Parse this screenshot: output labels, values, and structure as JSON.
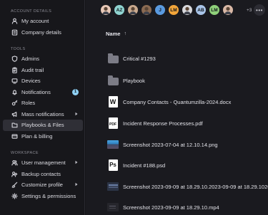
{
  "sidebar": {
    "account_section": "ACCOUNT DETAILS",
    "account_items": [
      {
        "label": "My account",
        "icon": "user-icon"
      },
      {
        "label": "Company details",
        "icon": "building-icon"
      }
    ],
    "tools_section": "TOOLS",
    "tools_items": [
      {
        "label": "Admins",
        "icon": "shield-icon"
      },
      {
        "label": "Audit trail",
        "icon": "clipboard-icon"
      },
      {
        "label": "Devices",
        "icon": "device-icon"
      },
      {
        "label": "Notifications",
        "icon": "bell-icon",
        "badge": "1"
      },
      {
        "label": "Roles",
        "icon": "key-icon"
      },
      {
        "label": "Mass notifications",
        "icon": "megaphone-icon"
      },
      {
        "label": "Playbooks & Files",
        "icon": "folder-icon",
        "active": true
      },
      {
        "label": "Plan & billing",
        "icon": "card-icon"
      }
    ],
    "workspace_section": "WORKSPACE",
    "workspace_items": [
      {
        "label": "User management",
        "icon": "users-icon"
      },
      {
        "label": "Backup contacts",
        "icon": "contacts-icon"
      },
      {
        "label": "Customize profile",
        "icon": "brush-icon"
      },
      {
        "label": "Settings & permissions",
        "icon": "gear-icon"
      }
    ]
  },
  "main": {
    "avatars": [
      {
        "initials": "",
        "color": "#e8c9b8"
      },
      {
        "initials": "AZ",
        "color": "#8fd3d0"
      },
      {
        "initials": "",
        "color": "#c9a98e"
      },
      {
        "initials": "",
        "color": "#8a6a52"
      },
      {
        "initials": "J",
        "color": "#5a9ae0"
      },
      {
        "initials": "LM",
        "color": "#f2a53a"
      },
      {
        "initials": "",
        "color": "#d8d8dc"
      },
      {
        "initials": "AB",
        "color": "#a9c4e8"
      },
      {
        "initials": "LM",
        "color": "#8fd07a"
      },
      {
        "initials": "",
        "color": "#d9b8a6"
      }
    ],
    "more_count": "+3",
    "more_button": "•••",
    "column_header": "Name",
    "sort_indicator": "↑",
    "files": [
      {
        "name": "Critical #1293",
        "type": "folder"
      },
      {
        "name": "Playbook",
        "type": "folder"
      },
      {
        "name": "Company Contacts - Quantumzilla-2024.docx",
        "type": "docx"
      },
      {
        "name": "Incident Response Processes.pdf",
        "type": "pdf"
      },
      {
        "name": "Screenshot 2023-07-04 at 12.10.14.png",
        "type": "image"
      },
      {
        "name": "Incident #188.psd",
        "type": "psd"
      },
      {
        "name": "Screenshot 2023-09-09 at 18.29.10.2023-09-09 at 18.29.1026",
        "type": "screenshot"
      },
      {
        "name": "Screenshot 2023-09-09 at 18.29.10.mp4",
        "type": "video"
      }
    ]
  }
}
